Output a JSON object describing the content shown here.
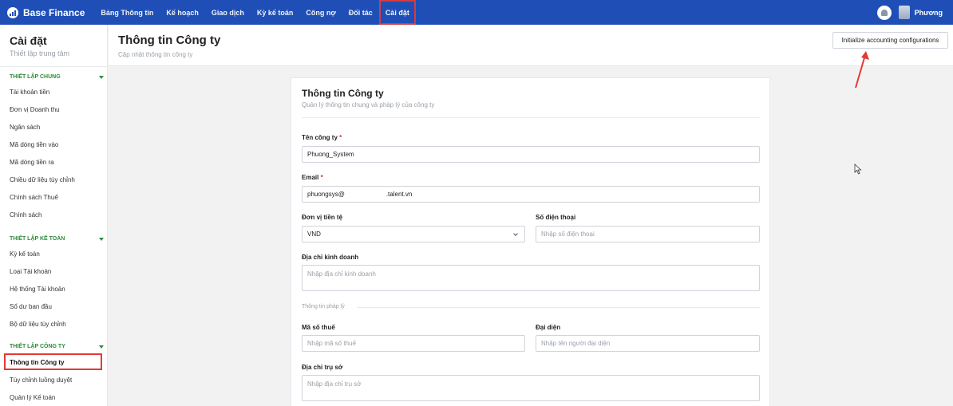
{
  "topbar": {
    "brand": "Base Finance",
    "nav": [
      "Bảng Thông tin",
      "Kế hoạch",
      "Giao dịch",
      "Kỳ kế toán",
      "Công nợ",
      "Đối tác",
      "Cài đặt"
    ],
    "active_nav": "Cài đặt",
    "user_name": "Phương",
    "bg_color": "#1f4fb6"
  },
  "sidebar": {
    "title": "Cài đặt",
    "subtitle": "Thiết lập trung tâm",
    "sections": [
      {
        "heading": "THIẾT LẬP CHUNG",
        "items": [
          "Tài khoản tiền",
          "Đơn vị Doanh thu",
          "Ngân sách",
          "Mã dòng tiền vào",
          "Mã dòng tiền ra",
          "Chiều dữ liệu tùy chỉnh",
          "Chính sách Thuế",
          "Chính sách"
        ]
      },
      {
        "heading": "THIẾT LẬP KẾ TOÁN",
        "items": [
          "Kỳ kế toán",
          "Loại Tài khoản",
          "Hệ thống Tài khoản",
          "Số dư ban đầu",
          "Bộ dữ liệu tùy chỉnh"
        ]
      },
      {
        "heading": "THIẾT LẬP CÔNG TY",
        "items": [
          "Thông tin Công ty",
          "Tùy chỉnh luồng duyệt",
          "Quản lý Kế toán"
        ]
      }
    ],
    "active_item": "Thông tin Công ty",
    "section_color": "#2e8b3a"
  },
  "header": {
    "title": "Thông tin Công ty",
    "subtitle": "Cập nhật thông tin công ty",
    "init_button": "Initialize accounting configurations"
  },
  "card": {
    "title": "Thông tin Công ty",
    "subtitle": "Quản lý thông tin chung và pháp lý của công ty",
    "company_name_label": "Tên công ty",
    "company_name_value": "Phuong_System",
    "email_label": "Email",
    "email_value": "phuongsys@",
    "email_suffix": ".talent.vn",
    "currency_label": "Đơn vị tiền tệ",
    "currency_value": "VND",
    "phone_label": "Số điện thoại",
    "phone_placeholder": "Nhập số điện thoại",
    "address_label": "Địa chỉ kinh doanh",
    "address_placeholder": "Nhập địa chỉ kinh doanh",
    "legal_heading": "Thông tin pháp lý",
    "tax_label": "Mã số thuế",
    "tax_placeholder": "Nhập mã số thuế",
    "rep_label": "Đại diện",
    "rep_placeholder": "Nhập tên người đại diện",
    "hq_label": "Địa chỉ trụ sở",
    "hq_placeholder": "Nhập địa chỉ trụ sở",
    "required_mark": "*"
  },
  "annotation_color": "#e53935"
}
